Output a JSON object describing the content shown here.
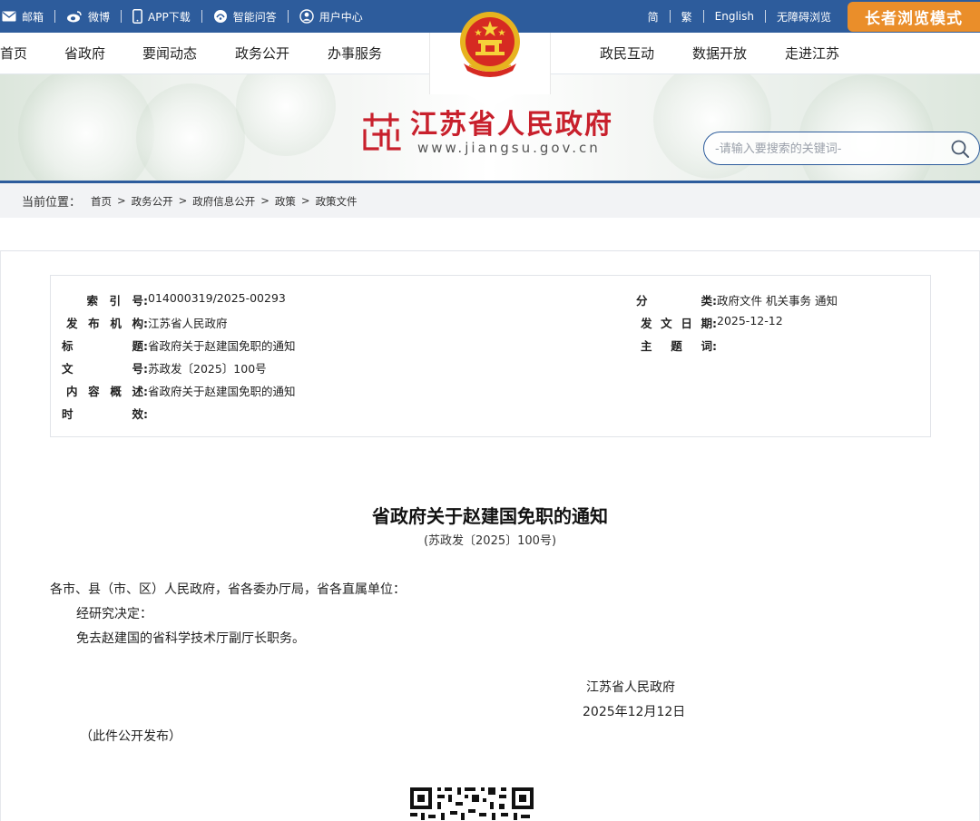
{
  "topbar": {
    "left": [
      {
        "icon": "mail-icon",
        "label": "邮箱"
      },
      {
        "icon": "weibo-icon",
        "label": "微博"
      },
      {
        "icon": "phone-icon",
        "label": "APP下载"
      },
      {
        "icon": "qa-icon",
        "label": "智能问答"
      },
      {
        "icon": "user-icon",
        "label": "用户中心"
      }
    ],
    "right": [
      "简",
      "繁",
      "English",
      "无障碍浏览"
    ],
    "elder_mode": "长者浏览模式"
  },
  "nav": {
    "left": [
      "首页",
      "省政府",
      "要闻动态",
      "政务公开",
      "办事服务"
    ],
    "right": [
      "政民互动",
      "数据开放",
      "走进江苏"
    ]
  },
  "banner": {
    "title": "江苏省人民政府",
    "url": "www.jiangsu.gov.cn",
    "search_placeholder": "-请输入要搜索的关键词-"
  },
  "breadcrumb": {
    "label": "当前位置：",
    "items": [
      "首页",
      "政务公开",
      "政府信息公开",
      "政策",
      "政策文件"
    ],
    "separator": ">"
  },
  "info": {
    "left": [
      {
        "key": [
          "索",
          "引",
          "号:"
        ],
        "value": "014000319/2025-00293"
      },
      {
        "key": [
          "发",
          "布",
          "机",
          "构:"
        ],
        "value": "江苏省人民政府"
      },
      {
        "key": [
          "标",
          "题:"
        ],
        "value": "省政府关于赵建国免职的通知"
      },
      {
        "key": [
          "文",
          "号:"
        ],
        "value": "苏政发〔2025〕100号"
      },
      {
        "key": [
          "内",
          "容",
          "概",
          "述:"
        ],
        "value": "省政府关于赵建国免职的通知"
      },
      {
        "key": [
          "时",
          "效:"
        ],
        "value": ""
      }
    ],
    "right": [
      {
        "key": [
          "分",
          "类:"
        ],
        "value": "政府文件 机关事务 通知"
      },
      {
        "key": [
          "发",
          "文",
          "日",
          "期:"
        ],
        "value": "2025-12-12"
      },
      {
        "key": [
          "主",
          "题",
          "词:"
        ],
        "value": ""
      }
    ]
  },
  "doc": {
    "title": "省政府关于赵建国免职的通知",
    "number": "(苏政发〔2025〕100号)",
    "addressee": "各市、县（市、区）人民政府，省各委办厅局，省各直属单位：",
    "para1": "经研究决定：",
    "para2": "免去赵建国的省科学技术厅副厅长职务。",
    "signer": "江苏省人民政府",
    "date": "2025年12月12日",
    "note": "（此件公开发布）"
  },
  "colors": {
    "primary": "#2d5c9c",
    "accent": "#ea8e2a",
    "brand_red": "#c8202c"
  }
}
